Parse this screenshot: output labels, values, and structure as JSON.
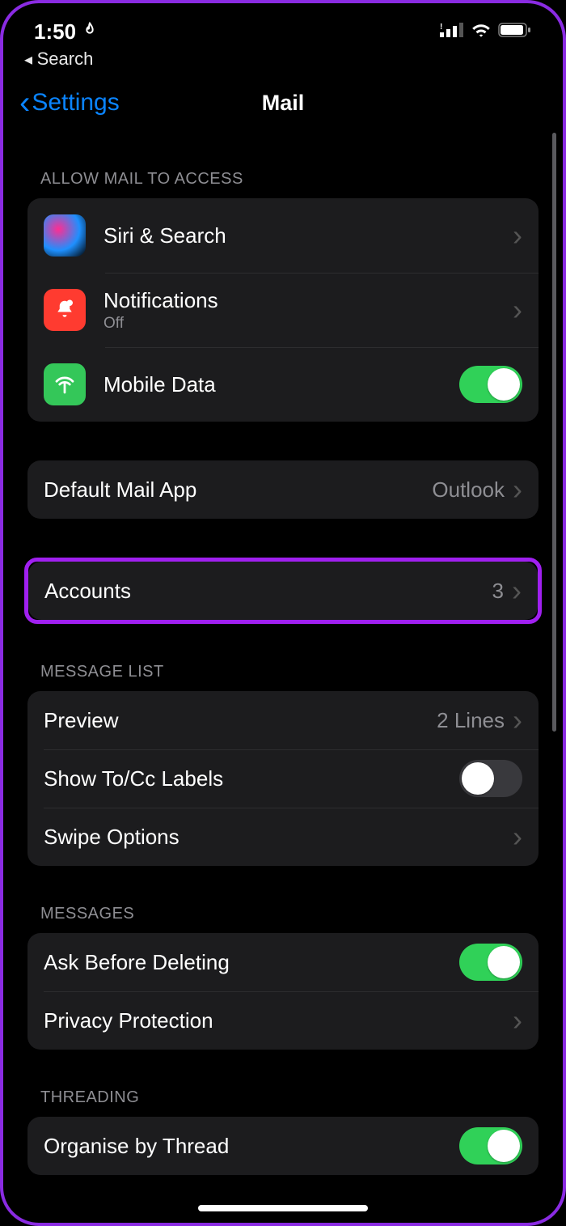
{
  "statusbar": {
    "time": "1:50",
    "breadcrumb": "Search"
  },
  "nav": {
    "back": "Settings",
    "title": "Mail"
  },
  "sections": {
    "access": {
      "header": "Allow Mail to Access",
      "siri": "Siri & Search",
      "notifications": {
        "label": "Notifications",
        "sub": "Off"
      },
      "mobile": {
        "label": "Mobile Data",
        "on": true
      }
    },
    "default": {
      "label": "Default Mail App",
      "value": "Outlook"
    },
    "accounts": {
      "label": "Accounts",
      "value": "3"
    },
    "messageList": {
      "header": "Message List",
      "preview": {
        "label": "Preview",
        "value": "2 Lines"
      },
      "tocc": {
        "label": "Show To/Cc Labels",
        "on": false
      },
      "swipe": "Swipe Options"
    },
    "messages": {
      "header": "Messages",
      "ask": {
        "label": "Ask Before Deleting",
        "on": true
      },
      "privacy": "Privacy Protection"
    },
    "threading": {
      "header": "Threading",
      "organise": {
        "label": "Organise by Thread",
        "on": true
      }
    }
  }
}
